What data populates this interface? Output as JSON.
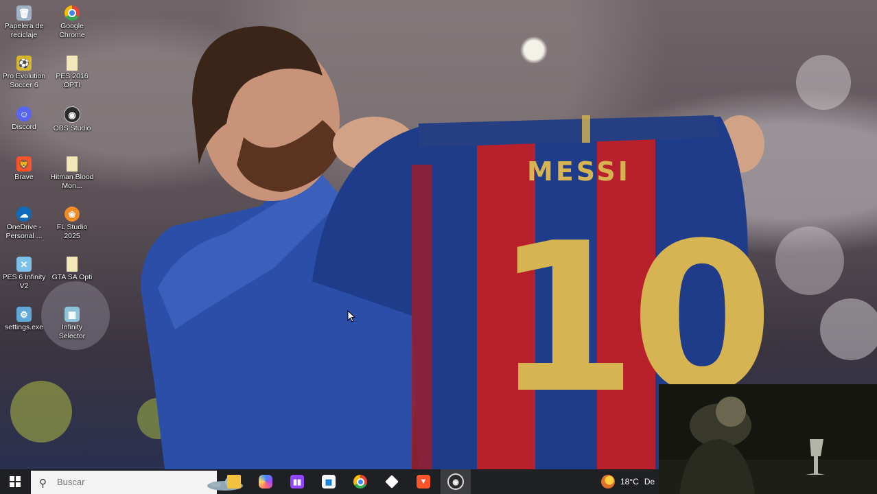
{
  "desktop": {
    "icons": [
      {
        "label": "Papelera de reciclaje",
        "icon": "recycle-bin-icon"
      },
      {
        "label": "Google Chrome",
        "icon": "chrome-icon"
      },
      {
        "label": "Pro Evolution Soccer 6",
        "icon": "pes6-icon"
      },
      {
        "label": "PES 2016 OPTI",
        "icon": "file-icon"
      },
      {
        "label": "Discord",
        "icon": "discord-icon"
      },
      {
        "label": "OBS Studio",
        "icon": "obs-icon"
      },
      {
        "label": "Brave",
        "icon": "brave-icon"
      },
      {
        "label": "Hitman Blood Mon...",
        "icon": "file-icon"
      },
      {
        "label": "OneDrive - Personal ...",
        "icon": "onedrive-icon"
      },
      {
        "label": "FL Studio 2025",
        "icon": "fl-studio-icon"
      },
      {
        "label": "PES 6 Infinity V2",
        "icon": "pes-infinity-icon"
      },
      {
        "label": "GTA SA Opti",
        "icon": "file-icon"
      },
      {
        "label": "settings.exe",
        "icon": "settings-gear-icon"
      },
      {
        "label": "Infinity Selector",
        "icon": "infinity-selector-icon"
      }
    ]
  },
  "wallpaper": {
    "jersey_name": "MESSI",
    "jersey_number": "10"
  },
  "taskbar": {
    "search_placeholder": "Buscar",
    "apps": [
      "file-explorer-icon",
      "copilot-icon",
      "twitch-icon",
      "microsoft-store-icon",
      "chrome-icon",
      "tiktok-like-icon",
      "brave-icon",
      "obs-icon"
    ],
    "weather_temp": "18°C",
    "weather_text": "De"
  },
  "colors": {
    "taskbar_bg": "#1f2023",
    "jersey_blue": "#1f3c8a",
    "jersey_red": "#b8202c",
    "jersey_gold": "#d7b452"
  }
}
